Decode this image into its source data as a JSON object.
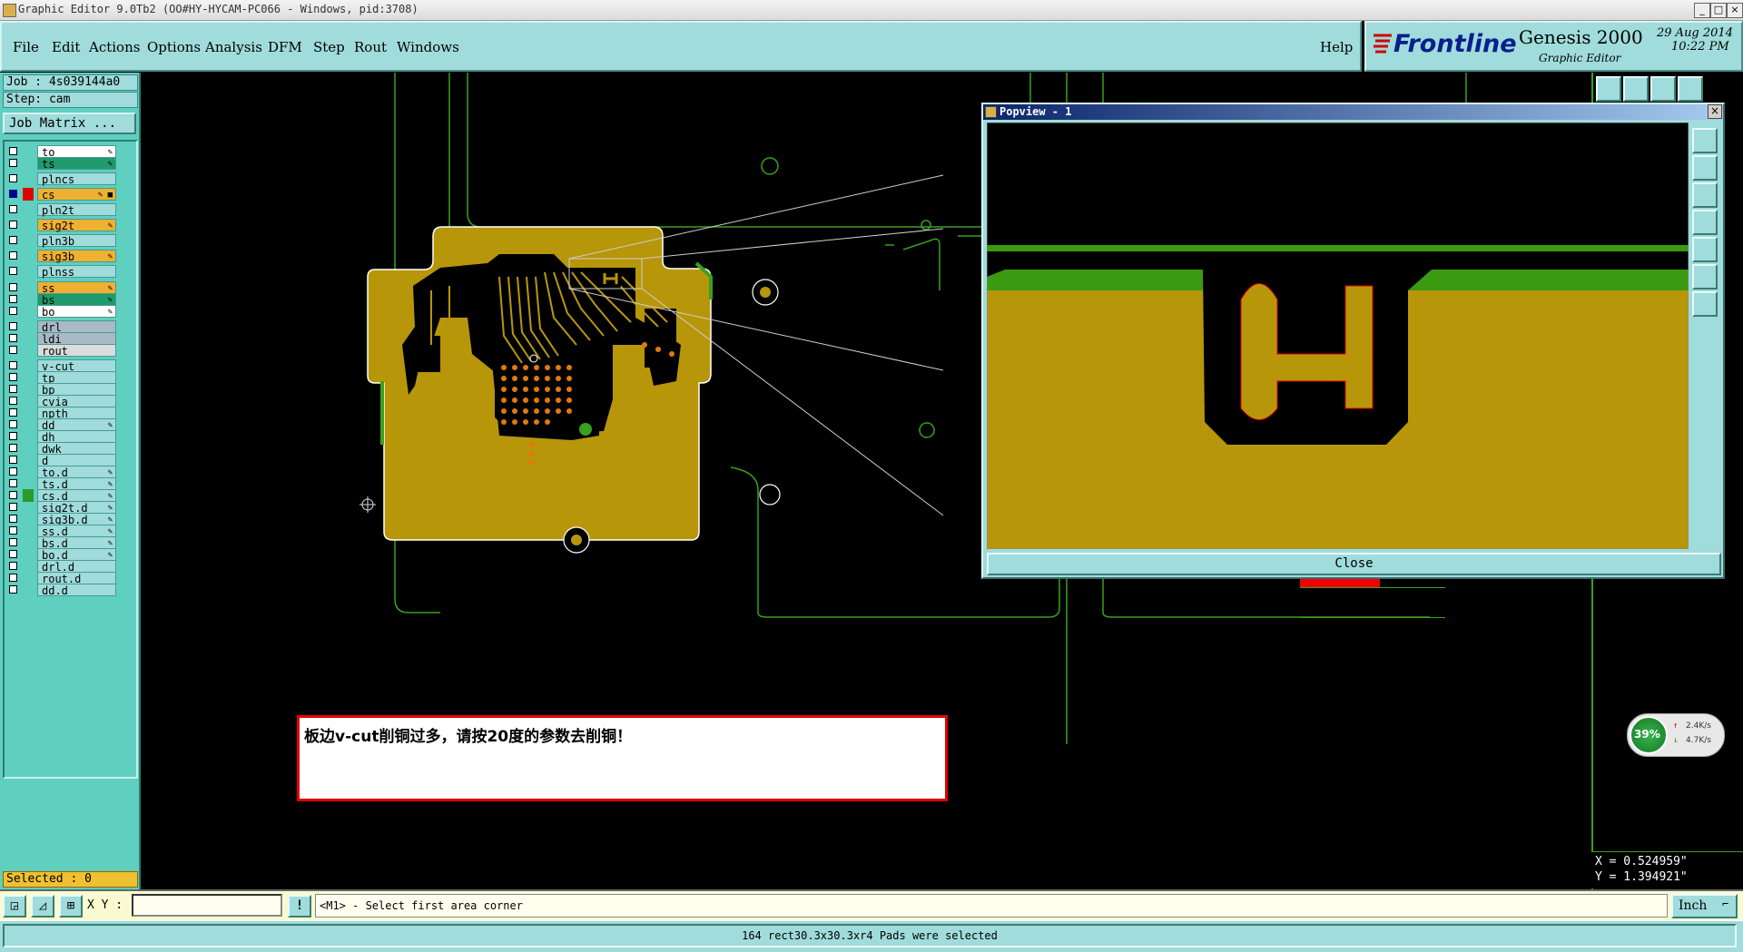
{
  "window": {
    "title": "Graphic Editor 9.0Tb2 (OO#HY-HYCAM-PC066 - Windows, pid:3708)",
    "controls": [
      "_",
      "□",
      "×"
    ]
  },
  "menubar": {
    "items": [
      "File",
      "Edit",
      "Actions",
      "Options",
      "Analysis",
      "DFM",
      "Step",
      "Rout",
      "Windows"
    ],
    "help": "Help"
  },
  "brand": {
    "logo": "Frontline",
    "product": "Genesis 2000",
    "subtitle": "Graphic Editor",
    "date": "29 Aug 2014",
    "time": "10:22 PM"
  },
  "job": {
    "job_label": "Job : 4s039144a0",
    "step_label": "Step: cam",
    "matrix_button": "Job Matrix ..."
  },
  "layers": [
    {
      "name": "to",
      "color": "#ffffff",
      "mark": "✎"
    },
    {
      "name": "ts",
      "color": "#1f9a6c",
      "mark": "✎"
    },
    {
      "name": "plncs",
      "color": "#9fdcdb",
      "mark": ""
    },
    {
      "name": "cs",
      "color": "#f0b030",
      "mark": "✎ ■",
      "active": true
    },
    {
      "name": "pln2t",
      "color": "#9fdcdb",
      "mark": ""
    },
    {
      "name": "sig2t",
      "color": "#f0b030",
      "mark": "✎"
    },
    {
      "name": "pln3b",
      "color": "#9fdcdb",
      "mark": ""
    },
    {
      "name": "sig3b",
      "color": "#f0b030",
      "mark": "✎"
    },
    {
      "name": "plnss",
      "color": "#9fdcdb",
      "mark": ""
    },
    {
      "name": "ss",
      "color": "#f0b030",
      "mark": "✎"
    },
    {
      "name": "bs",
      "color": "#1f9a6c",
      "mark": "✎"
    },
    {
      "name": "bo",
      "color": "#ffffff",
      "mark": "✎"
    },
    {
      "name": "drl",
      "color": "#a9b9c5",
      "mark": ""
    },
    {
      "name": "ldi",
      "color": "#a9b9c5",
      "mark": ""
    },
    {
      "name": "rout",
      "color": "#dcdcdc",
      "mark": ""
    },
    {
      "name": "v-cut",
      "color": "#9fdcdb",
      "mark": ""
    },
    {
      "name": "tp",
      "color": "#9fdcdb",
      "mark": ""
    },
    {
      "name": "bp",
      "color": "#9fdcdb",
      "mark": ""
    },
    {
      "name": "cvia",
      "color": "#9fdcdb",
      "mark": ""
    },
    {
      "name": "npth",
      "color": "#9fdcdb",
      "mark": ""
    },
    {
      "name": "dd",
      "color": "#9fdcdb",
      "mark": "✎"
    },
    {
      "name": "dh",
      "color": "#9fdcdb",
      "mark": ""
    },
    {
      "name": "dwk",
      "color": "#9fdcdb",
      "mark": ""
    },
    {
      "name": "d",
      "color": "#9fdcdb",
      "mark": ""
    },
    {
      "name": "to.d",
      "color": "#9fdcdb",
      "mark": "✎"
    },
    {
      "name": "ts.d",
      "color": "#9fdcdb",
      "mark": "✎"
    },
    {
      "name": "cs.d",
      "color": "#9fdcdb",
      "mark": "✎",
      "green": true
    },
    {
      "name": "sig2t.d",
      "color": "#9fdcdb",
      "mark": "✎"
    },
    {
      "name": "sig3b.d",
      "color": "#9fdcdb",
      "mark": "✎"
    },
    {
      "name": "ss.d",
      "color": "#9fdcdb",
      "mark": "✎"
    },
    {
      "name": "bs.d",
      "color": "#9fdcdb",
      "mark": "✎"
    },
    {
      "name": "bo.d",
      "color": "#9fdcdb",
      "mark": "✎"
    },
    {
      "name": "drl.d",
      "color": "#9fdcdb",
      "mark": ""
    },
    {
      "name": "rout.d",
      "color": "#9fdcdb",
      "mark": ""
    },
    {
      "name": "dd.d",
      "color": "#9fdcdb",
      "mark": ""
    }
  ],
  "selected": "Selected : 0",
  "popview": {
    "title": "Popview - 1",
    "close": "Close",
    "close_x": "×"
  },
  "message": "板边v-cut削铜过多，请按20度的参数去削铜！",
  "net_widget": {
    "percent": "39%",
    "up": "2.4K/s",
    "down": "4.7K/s"
  },
  "coords": {
    "x": "X = 0.524959\"",
    "y": "Y = 1.394921\""
  },
  "command": {
    "xy_label": "X Y :",
    "xy_value": "",
    "alert": "!",
    "prompt": "<M1> - Select first area corner",
    "units": "Inch"
  },
  "status": "164 rect30.3x30.3xr4 Pads were selected",
  "colors": {
    "copper": "#b8960a",
    "green": "#3a9a10",
    "board_bg": "#000000",
    "panel": "#9fdcdb",
    "outline": "#3aa020"
  }
}
